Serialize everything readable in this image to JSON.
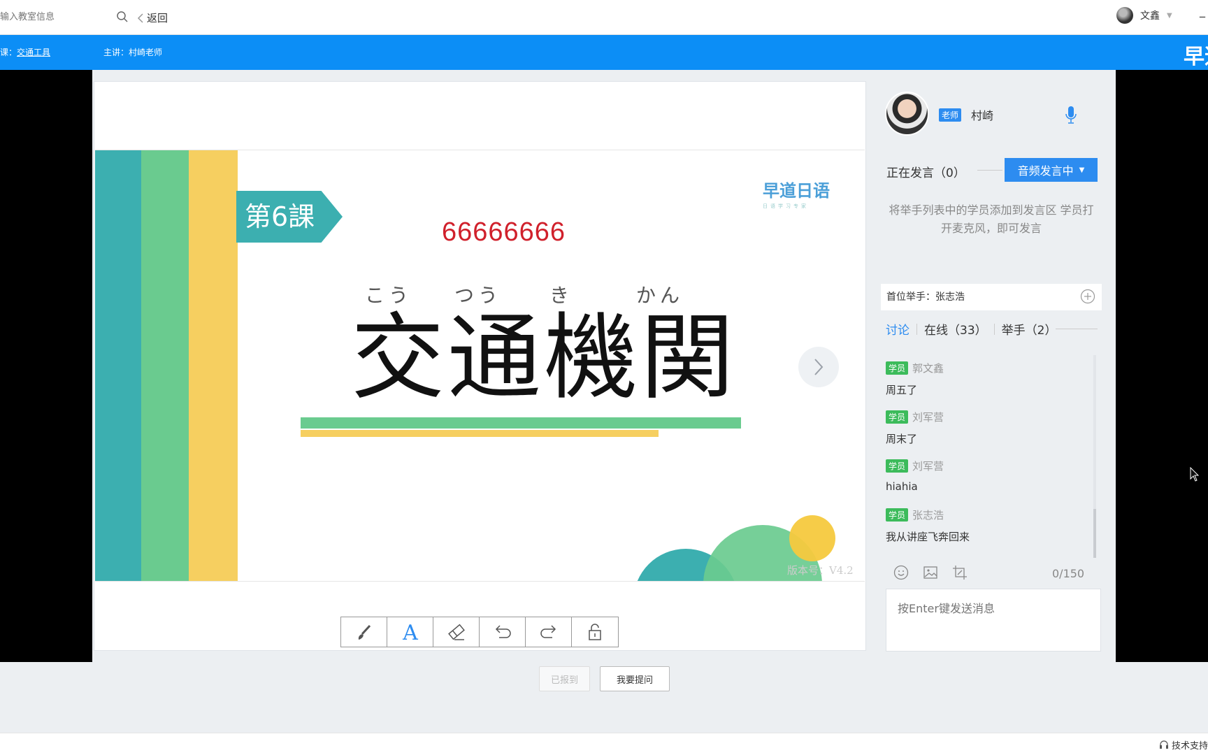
{
  "topbar": {
    "search_placeholder": "输入教室信息",
    "back_label": "返回",
    "username": "文鑫",
    "minimize": "_"
  },
  "bluebar": {
    "course_prefix": "课：",
    "course_name": "交通工具",
    "teacher_label": "主讲：村崎老师",
    "brand": "早道"
  },
  "slide": {
    "lesson": "第6課",
    "logo": "早道日语",
    "logo_sub": "日语学习专家",
    "red_text": "66666666",
    "furigana": [
      "こう",
      "つう",
      "き",
      "かん"
    ],
    "title": "交通機関",
    "version": "版本号：V4.2",
    "colors": {
      "teal": "#3cafb0",
      "green": "#6acb8f",
      "yellow": "#f6cf60"
    }
  },
  "toolbar": {
    "tools": [
      "brush-icon",
      "text-icon",
      "eraser-icon",
      "undo-icon",
      "redo-icon",
      "lock-icon"
    ]
  },
  "actions": {
    "checked_in": "已报到",
    "ask": "我要提问"
  },
  "sidebar": {
    "teacher_role": "老师",
    "teacher_name": "村崎",
    "speaking_label": "正在发言（0）",
    "audio_button": "音频发言中",
    "hint": "将举手列表中的学员添加到发言区 学员打开麦克风，即可发言",
    "first_hand_label": "首位举手：",
    "first_hand_name": "张志浩",
    "tabs": [
      "讨论",
      "在线（33）",
      "举手（2）"
    ],
    "chat": [
      {
        "badge": "学员",
        "name": "郭文鑫",
        "text": "周五了"
      },
      {
        "badge": "学员",
        "name": "刘军营",
        "text": "周末了"
      },
      {
        "badge": "学员",
        "name": "刘军营",
        "text": "hiahia"
      },
      {
        "badge": "学员",
        "name": "张志浩",
        "text": "我从讲座飞奔回来"
      }
    ],
    "counter": "0/150",
    "input_placeholder": "按Enter键发送消息"
  },
  "footer": {
    "tech_support": "技术支持"
  }
}
